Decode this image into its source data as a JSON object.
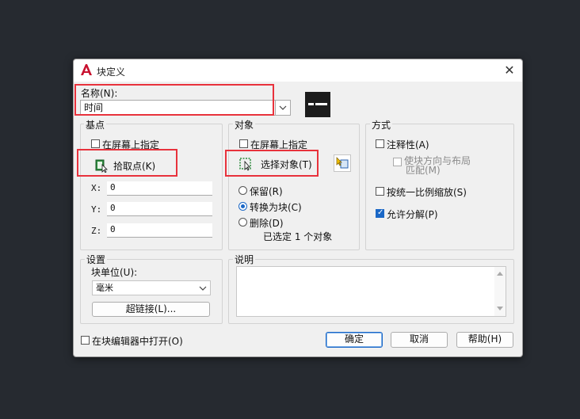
{
  "window": {
    "title": "块定义",
    "close_glyph": "✕"
  },
  "name": {
    "label": "名称(N):",
    "value": "时间"
  },
  "base_point": {
    "title": "基点",
    "specify_on_screen": "在屏幕上指定",
    "pick_point": "拾取点(K)",
    "x_label": "X:",
    "x_value": "0",
    "y_label": "Y:",
    "y_value": "0",
    "z_label": "Z:",
    "z_value": "0"
  },
  "objects": {
    "title": "对象",
    "specify_on_screen": "在屏幕上指定",
    "select_objects": "选择对象(T)",
    "retain": "保留(R)",
    "convert_to_block": "转换为块(C)",
    "delete": "删除(D)",
    "selected_count": "已选定 1 个对象"
  },
  "behavior": {
    "title": "方式",
    "annotative": "注释性(A)",
    "match_orientation_line1": "使块方向与布局",
    "match_orientation_line2": "匹配(M)",
    "scale_uniformly": "按统一比例缩放(S)",
    "allow_exploding": "允许分解(P)"
  },
  "settings": {
    "title": "设置",
    "block_unit_label": "块单位(U):",
    "block_unit_value": "毫米",
    "hyperlink": "超链接(L)..."
  },
  "description": {
    "title": "说明"
  },
  "footer": {
    "open_in_editor": "在块编辑器中打开(O)",
    "ok": "确定",
    "cancel": "取消",
    "help": "帮助(H)"
  }
}
